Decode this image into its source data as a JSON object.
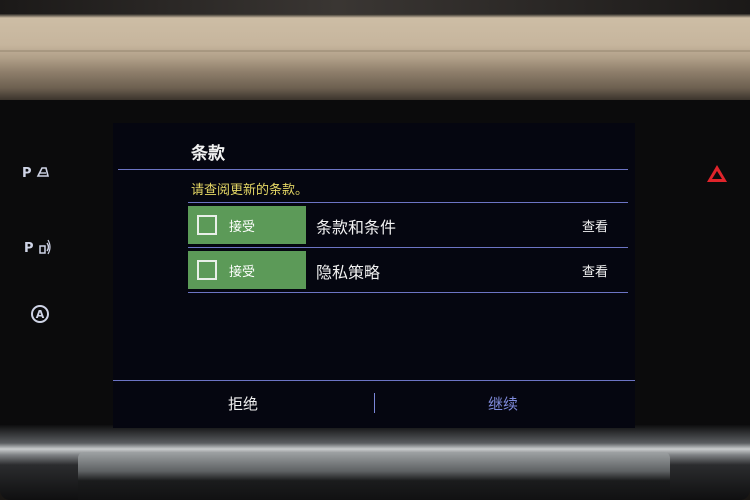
{
  "screen": {
    "title": "条款",
    "instruction": "请查阅更新的条款。",
    "rows": [
      {
        "accept_label": "接受",
        "label": "条款和条件",
        "view_label": "查看"
      },
      {
        "accept_label": "接受",
        "label": "隐私策略",
        "view_label": "查看"
      }
    ],
    "footer": {
      "decline_label": "拒绝",
      "continue_label": "继续"
    }
  },
  "side_buttons": {
    "park_assist_label": "P",
    "park_sensor_label": "P",
    "auto_label": "A"
  },
  "colors": {
    "accept_green": "#5c9a58",
    "instruction_yellow": "#e5d765",
    "divider_blue": "#6c74c4",
    "continue_blue": "#7f8bdc",
    "hazard_red": "#e0242b"
  },
  "icons": [
    "park-assist-icon",
    "park-sensor-icon",
    "auto-stop-icon",
    "hazard-icon"
  ]
}
